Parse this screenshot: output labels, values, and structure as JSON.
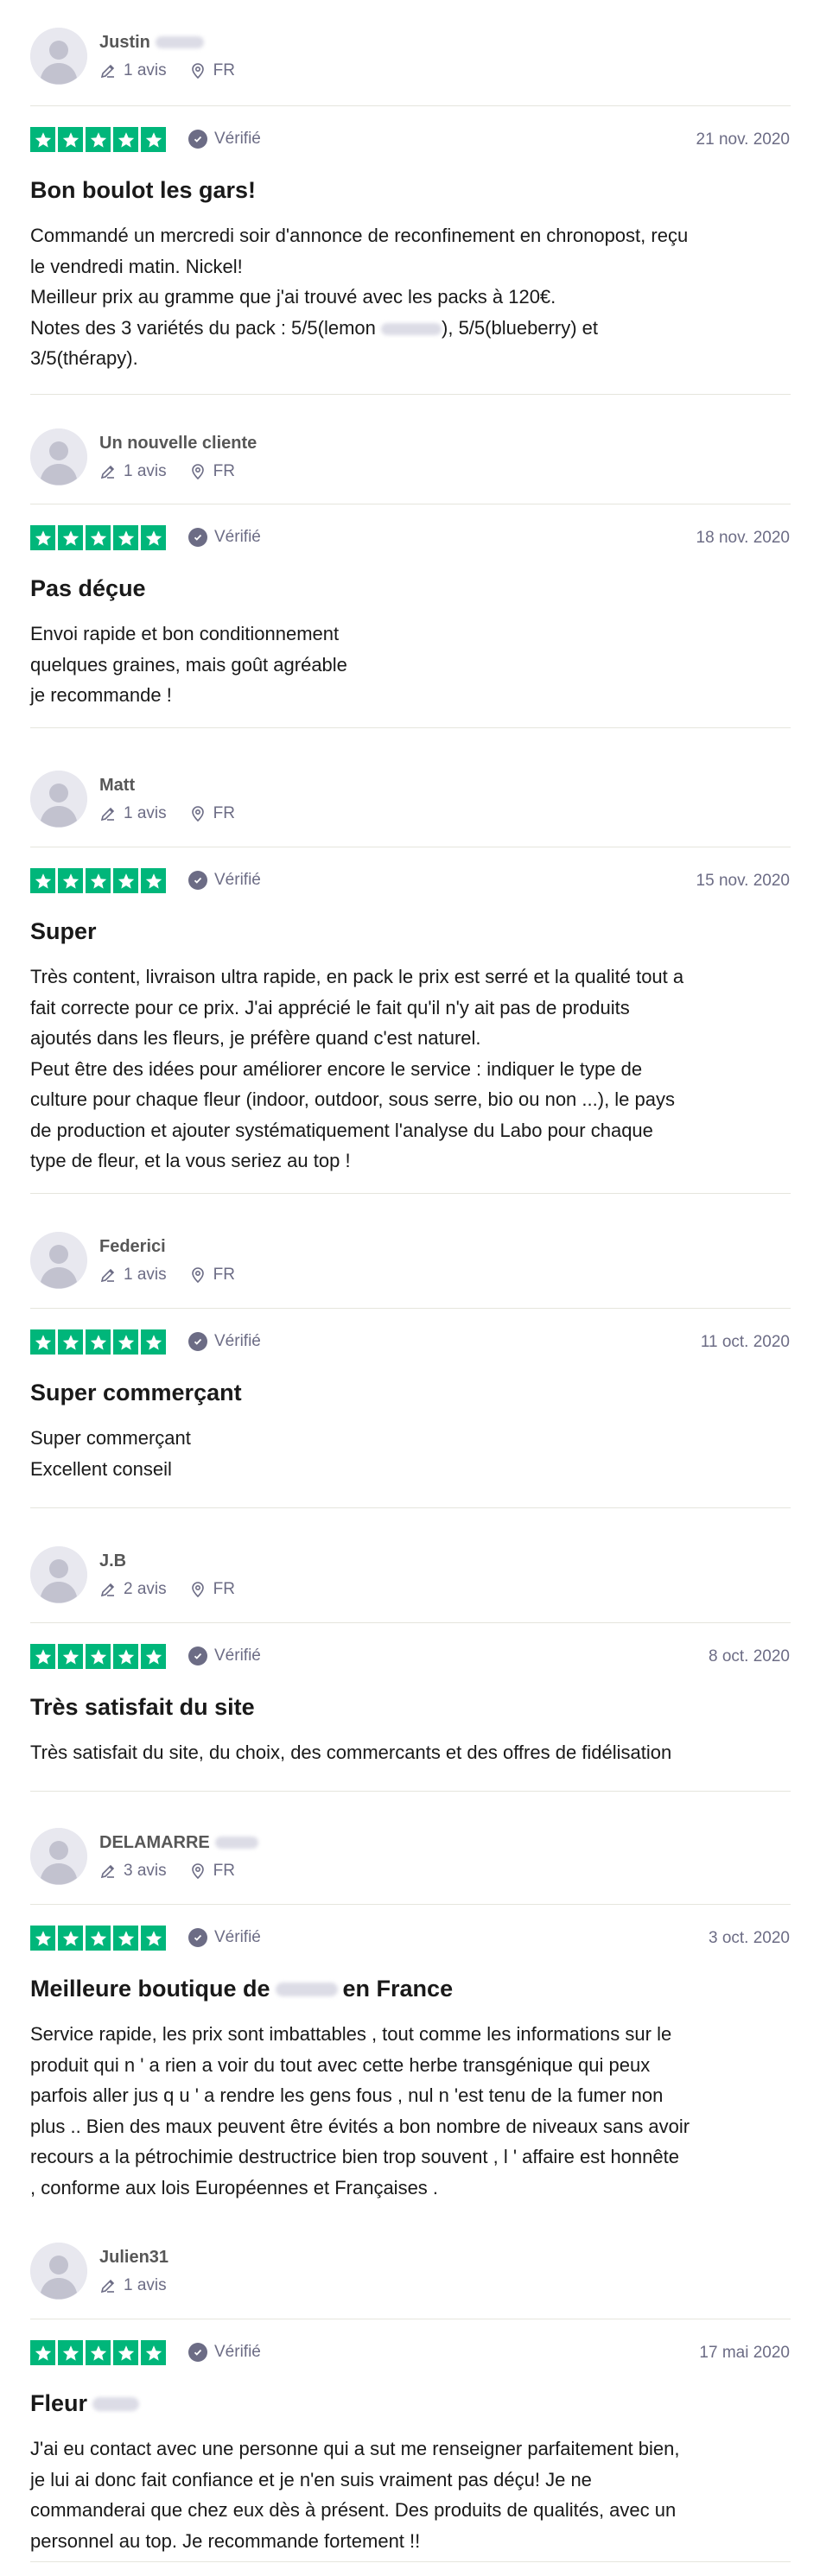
{
  "labels": {
    "verified": "Vérifié"
  },
  "colors": {
    "star_green": "#00b67a",
    "meta_gray": "#6c6c85",
    "separator": "#e5e5dd",
    "avatar_bg": "#e8e8ef"
  },
  "icons": {
    "avatar": "default-user-avatar",
    "reviews": "pencil-icon",
    "location": "map-pin-icon",
    "star": "star-icon",
    "verified": "checkmark-circle-icon"
  },
  "reviews": [
    {
      "name": "Justin",
      "reviews_count": "1 avis",
      "country": "FR",
      "rating": 5,
      "date": "21 nov. 2020",
      "title": "Bon boulot les gars!",
      "lines": [
        "Commandé un mercredi soir d'annonce de reconfinement en chronopost, reçu",
        "le vendredi matin. Nickel!",
        "Meilleur prix au gramme que j'ai trouvé avec les packs à 120€."
      ],
      "line_split_a": "Notes des 3 variétés du pack : 5/5(lemon",
      "line_split_b": "), 5/5(blueberry) et",
      "line_last": "3/5(thérapy)."
    },
    {
      "name": "Un nouvelle cliente",
      "reviews_count": "1 avis",
      "country": "FR",
      "rating": 5,
      "date": "18 nov. 2020",
      "title": "Pas déçue",
      "lines": [
        "Envoi rapide et bon conditionnement",
        "quelques graines, mais goût agréable",
        "je recommande !"
      ]
    },
    {
      "name": "Matt",
      "reviews_count": "1 avis",
      "country": "FR",
      "rating": 5,
      "date": "15 nov. 2020",
      "title": "Super",
      "lines": [
        "Très content, livraison ultra rapide, en pack le prix est serré et la qualité tout a",
        "fait correcte pour ce prix. J'ai apprécié le fait qu'il n'y ait pas de produits",
        "ajoutés dans les fleurs, je préfère quand c'est naturel.",
        "Peut être des idées pour améliorer encore le service : indiquer le type de",
        "culture pour chaque fleur (indoor, outdoor, sous serre, bio ou non ...), le pays",
        "de production et ajouter systématiquement l'analyse du Labo pour chaque",
        "type de fleur, et la vous seriez au top !"
      ]
    },
    {
      "name": "Federici",
      "reviews_count": "1 avis",
      "country": "FR",
      "rating": 5,
      "date": "11 oct. 2020",
      "title": "Super commerçant",
      "lines": [
        "Super commerçant",
        "Excellent conseil"
      ]
    },
    {
      "name": "J.B",
      "reviews_count": "2 avis",
      "country": "FR",
      "rating": 5,
      "date": "8 oct. 2020",
      "title": "Très satisfait du site",
      "lines": [
        "Très satisfait du site, du choix, des commercants et des offres de fidélisation"
      ]
    },
    {
      "name": "DELAMARRE",
      "reviews_count": "3 avis",
      "country": "FR",
      "rating": 5,
      "date": "3 oct. 2020",
      "title_a": "Meilleure boutique de",
      "title_b": "en France",
      "lines": [
        "Service rapide, les prix sont imbattables , tout comme les informations sur le",
        "produit qui n ' a rien a voir du tout avec cette herbe transgénique qui peux",
        "parfois aller jus q u ' a rendre les gens fous , nul n 'est tenu de la fumer non",
        "plus .. Bien des maux peuvent être évités a bon nombre de niveaux sans avoir",
        "recours a la pétrochimie destructrice bien trop souvent , l ' affaire est honnête",
        ", conforme aux lois Européennes et Françaises ."
      ]
    },
    {
      "name": "Julien31",
      "reviews_count": "1 avis",
      "rating": 5,
      "date": "17 mai 2020",
      "title": "Fleur",
      "lines": [
        "J'ai eu contact avec une personne qui a sut me renseigner parfaitement bien,",
        "je lui ai donc fait confiance et je n'en suis vraiment pas déçu! Je ne",
        "commanderai que chez eux dès à présent. Des produits de qualités, avec un",
        "personnel au top. Je recommande fortement !!"
      ]
    }
  ]
}
